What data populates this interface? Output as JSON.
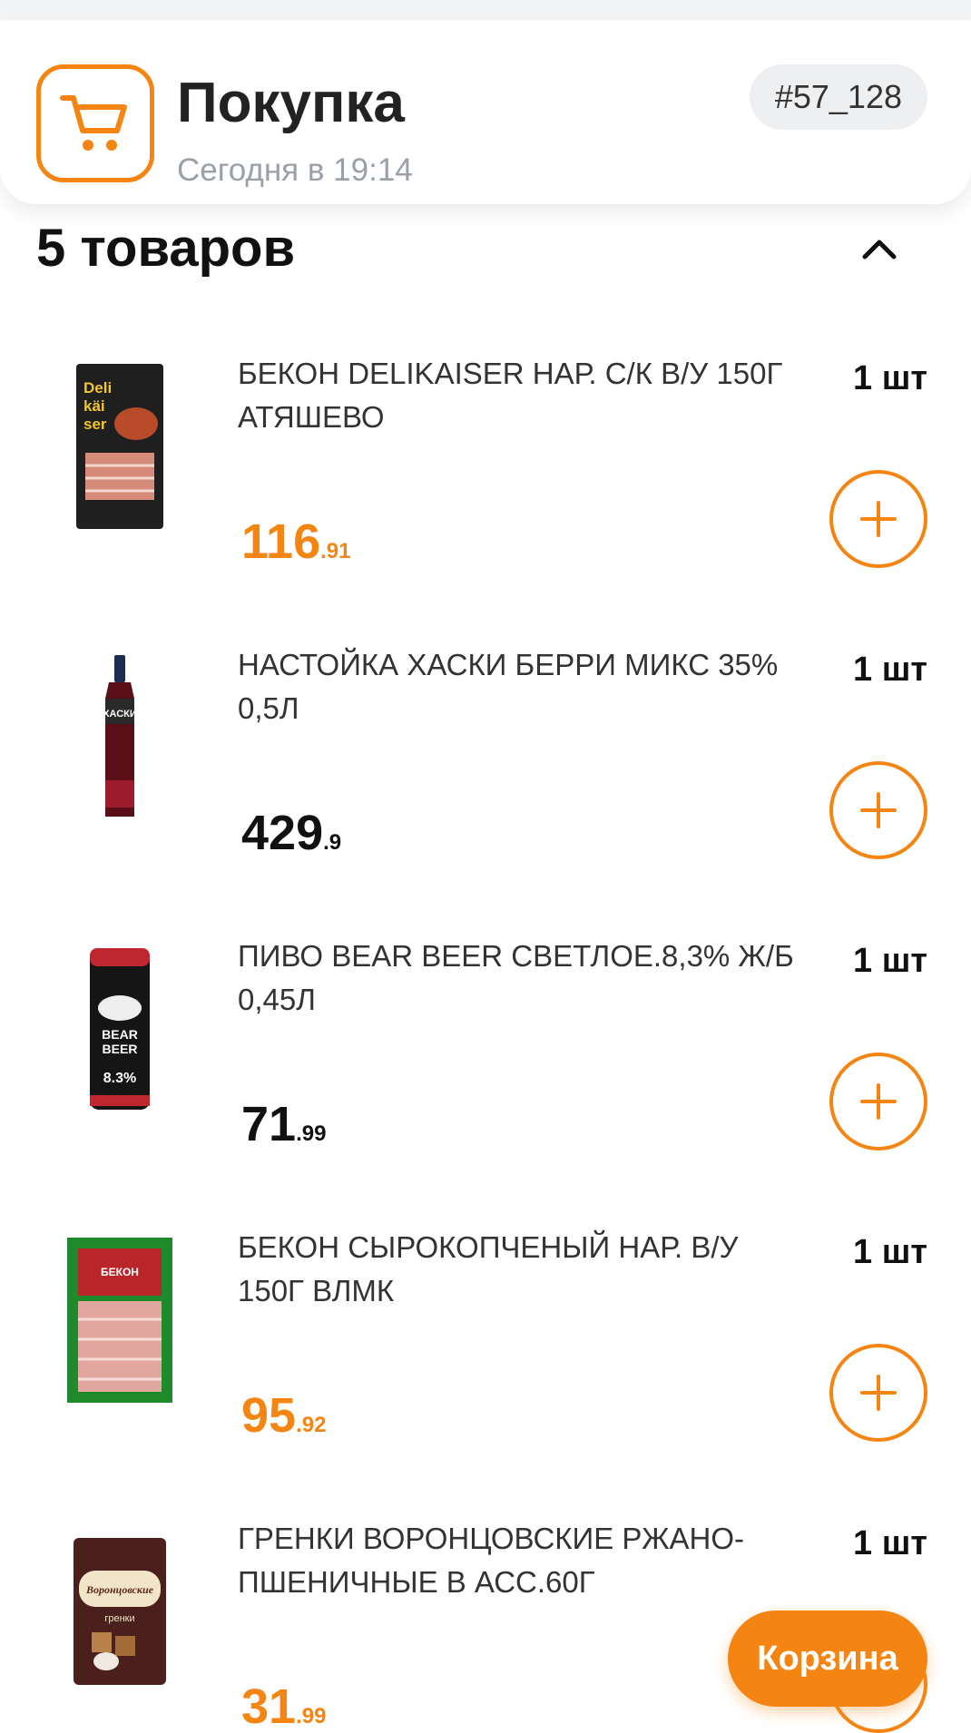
{
  "header": {
    "title": "Покупка",
    "subtitle": "Сегодня в 19:14",
    "order_id": "#57_128"
  },
  "section": {
    "title": "5 товаров"
  },
  "items": [
    {
      "name": "БЕКОН DELIKAISER НАР. С/К В/У 150Г АТЯШЕВО",
      "qty": "1 шт",
      "price_int": "116",
      "price_frac": ".91",
      "promo": true,
      "thumb_text": "Deli käi ser"
    },
    {
      "name": "НАСТОЙКА ХАСКИ БЕРРИ МИКС 35% 0,5Л",
      "qty": "1 шт",
      "price_int": "429",
      "price_frac": ".9",
      "promo": false,
      "thumb_text": "ХАСКИ"
    },
    {
      "name": "ПИВО BEAR BEER СВЕТЛОЕ.8,3% Ж/Б 0,45Л",
      "qty": "1 шт",
      "price_int": "71",
      "price_frac": ".99",
      "promo": false,
      "thumb_text": "BEAR BEER 8.3%"
    },
    {
      "name": "БЕКОН СЫРОКОПЧЕНЫЙ НАР. В/У 150Г ВЛМК",
      "qty": "1 шт",
      "price_int": "95",
      "price_frac": ".92",
      "promo": true,
      "thumb_text": "БЕКОН"
    },
    {
      "name": "ГРЕНКИ ВОРОНЦОВСКИЕ РЖАНО-ПШЕНИЧНЫЕ В АСС.60Г",
      "qty": "1 шт",
      "price_int": "31",
      "price_frac": ".99",
      "promo": true,
      "thumb_text": "Воронцовские гренки"
    }
  ],
  "cart_button": {
    "label": "Корзина"
  },
  "colors": {
    "accent": "#f58512",
    "muted": "#9aa0a8"
  }
}
